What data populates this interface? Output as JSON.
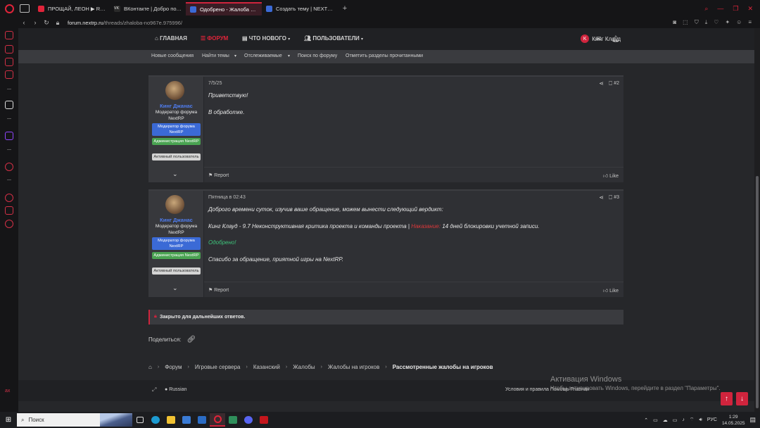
{
  "browser": {
    "tabs": [
      {
        "label": "ПРОЩАЙ, ЛЕОН ▶ Resid",
        "active": false,
        "color": "#e0243a"
      },
      {
        "label": "ВКонтакте | Добро пожа",
        "active": false,
        "color": "#2a2a2a"
      },
      {
        "label": "Одобрено - Жалоба №9",
        "active": true,
        "color": "#3b6ad6"
      },
      {
        "label": "Создать тему | NEXTRP",
        "active": false,
        "color": "#3b6ad6"
      }
    ],
    "new_tab": "+",
    "url_domain": "forum.nextrp.ru",
    "url_path": "/threads/zhaloba-no967e.975996/"
  },
  "forum_nav": {
    "items": [
      "ГЛАВНАЯ",
      "ФОРУМ",
      "ЧТО НОВОГО",
      "ПОЛЬЗОВАТЕЛИ"
    ],
    "user_initial": "K",
    "user_name": "Кинг Клауд",
    "sub_items": [
      "Новые сообщения",
      "Найти темы",
      "Отслеживаемые",
      "Поиск по форуму",
      "Отметить разделы прочитанными"
    ]
  },
  "posts": [
    {
      "author": "Кинг Джанас",
      "title": "Модератор форума NextRP",
      "badges": [
        "Модератор форума NextRP",
        "Администрация NextRP",
        "Активный пользователь"
      ],
      "date": "7/5/25",
      "number": "#2",
      "lines": [
        "Приветствую!",
        "В обработке."
      ],
      "report": "Report",
      "like": "Like"
    },
    {
      "author": "Кинг Джанас",
      "title": "Модератор форума NextRP",
      "badges": [
        "Модератор форума NextRP",
        "Администрация NextRP",
        "Активный пользователь"
      ],
      "date": "Пятница в 02:43",
      "number": "#3",
      "line1": "Доброго времени суток, изучив ваше обращение, можем вынести следующий вердикт:",
      "verdict_prefix": "Кинг Клауд - 9.7 Неконструктивная критика проекта и команды проекта |",
      "verdict_punish": "Наказание:",
      "verdict_suffix": "14 дней блокировки учетной записи.",
      "approved": "Одобрено!",
      "thanks": "Спасибо за обращение, приятной игры на NextRP.",
      "report": "Report",
      "like": "Like"
    }
  ],
  "closed_notice": "Закрыто для дальнейших ответов.",
  "share_label": "Поделиться:",
  "breadcrumbs": [
    "Форум",
    "Игровые сервера",
    "Казанский",
    "Жалобы",
    "Жалобы на игроков",
    "Рассмотренные жалобы на игроков"
  ],
  "footer": {
    "language": "Russian",
    "links": "Условия и правила   Помощь   Главная"
  },
  "watermark": {
    "title": "Активация Windows",
    "subtitle": "Чтобы активировать Windows, перейдите в раздел \"Параметры\"."
  },
  "taskbar": {
    "search_placeholder": "Поиск",
    "lang": "РУС",
    "time": "1:29",
    "date": "14.05.2025"
  }
}
